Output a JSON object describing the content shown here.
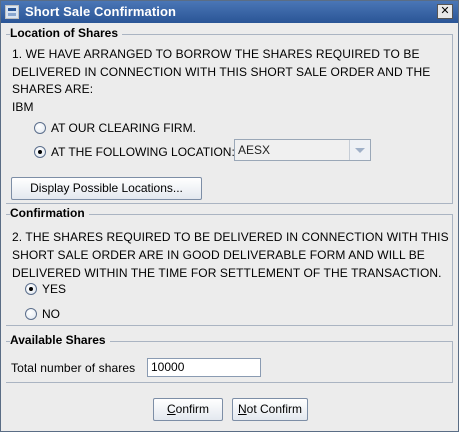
{
  "window": {
    "title": "Short Sale Confirmation",
    "close_glyph": "✕"
  },
  "location": {
    "heading": "Location of Shares",
    "statement_line1": "1. WE HAVE ARRANGED TO BORROW THE SHARES REQUIRED TO BE",
    "statement_line2": "DELIVERED IN CONNECTION WITH THIS SHORT SALE ORDER AND THE",
    "statement_line3": "SHARES ARE:",
    "symbol": "IBM",
    "option_clearing": "AT OUR CLEARING FIRM.",
    "option_following": "AT THE FOLLOWING LOCATION:",
    "selected_option": "following",
    "location_value": "AESX",
    "display_button": "Display Possible Locations..."
  },
  "confirmation": {
    "heading": "Confirmation",
    "statement_line1": "2. THE SHARES REQUIRED TO BE DELIVERED IN CONNECTION WITH THIS",
    "statement_line2": "SHORT SALE ORDER ARE IN GOOD DELIVERABLE FORM AND WILL BE",
    "statement_line3": "DELIVERED WITHIN THE TIME FOR SETTLEMENT OF THE TRANSACTION.",
    "option_yes": "YES",
    "option_no": "NO",
    "selected_option": "yes"
  },
  "available": {
    "heading": "Available Shares",
    "total_label": "Total number of shares",
    "total_value": "10000"
  },
  "buttons": {
    "confirm_mnemonic": "C",
    "confirm_rest": "onfirm",
    "not_confirm_mnemonic": "N",
    "not_confirm_rest": "ot Confirm"
  }
}
